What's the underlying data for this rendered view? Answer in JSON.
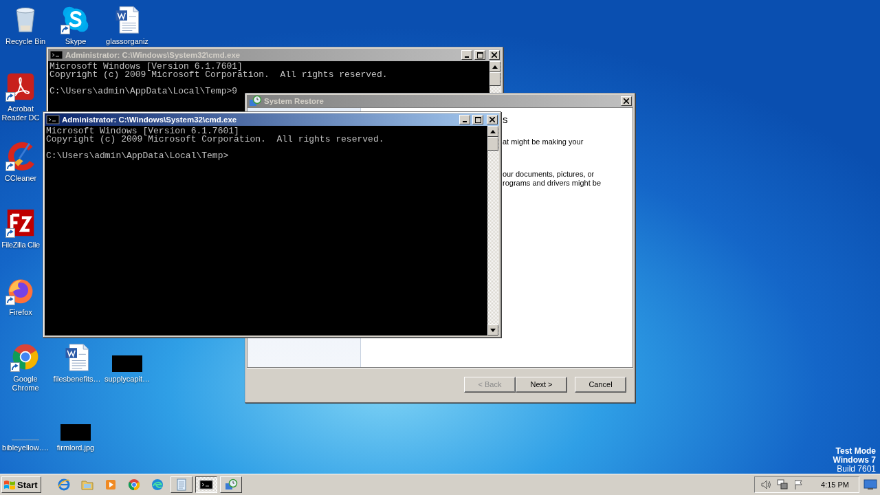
{
  "desktop_icons": [
    {
      "label": "Recycle Bin",
      "kind": "recycle",
      "shortcut": false
    },
    {
      "label": "Skype",
      "kind": "skype",
      "shortcut": true
    },
    {
      "label": "glassorganiz",
      "kind": "word",
      "shortcut": false
    },
    {
      "label": "Acrobat Reader DC",
      "kind": "acrobat",
      "shortcut": true
    },
    {
      "label": "CCleaner",
      "kind": "ccleaner",
      "shortcut": true
    },
    {
      "label": "FileZilla Clie",
      "kind": "filezilla",
      "shortcut": true
    },
    {
      "label": "Firefox",
      "kind": "firefox",
      "shortcut": true
    },
    {
      "label": "Google Chrome",
      "kind": "chrome",
      "shortcut": true
    },
    {
      "label": "filesbenefits…",
      "kind": "word",
      "shortcut": false
    },
    {
      "label": "supplycapit…",
      "kind": "blackimage",
      "shortcut": false
    },
    {
      "label": "bibleyellow….",
      "kind": "blank",
      "shortcut": false
    },
    {
      "label": "firmlord.jpg",
      "kind": "blackimage",
      "shortcut": false
    }
  ],
  "windows": [
    {
      "kind": "console",
      "title": "Administrator: C:\\Windows\\System32\\cmd.exe",
      "active": false,
      "output": [
        "Microsoft Windows [Version 6.1.7601]",
        "Copyright (c) 2009 Microsoft Corporation.  All rights reserved."
      ],
      "prompt": "C:\\Users\\admin\\AppData\\Local\\Temp>9"
    },
    {
      "kind": "wizard",
      "title": "System Restore",
      "active": false,
      "paragraphs": [
        {
          "kind": "heading",
          "lines": [
            "s"
          ]
        },
        {
          "kind": "body",
          "lines": [
            "at might be making your"
          ]
        },
        {
          "kind": "body",
          "lines": [
            "our documents, pictures, or",
            "rograms and drivers might be"
          ]
        }
      ],
      "buttons": [
        {
          "label": "< Back",
          "disabled": true
        },
        {
          "label": "Next >",
          "disabled": false
        },
        {
          "label": "Cancel",
          "disabled": false
        }
      ]
    },
    {
      "kind": "console",
      "title": "Administrator: C:\\Windows\\System32\\cmd.exe",
      "active": true,
      "output": [
        "Microsoft Windows [Version 6.1.7601]",
        "Copyright (c) 2009 Microsoft Corporation.  All rights reserved."
      ],
      "prompt": "C:\\Users\\admin\\AppData\\Local\\Temp>"
    }
  ],
  "os_notice": [
    "Test Mode",
    "Windows 7",
    "Build 7601"
  ],
  "taskbar": {
    "start": "Start",
    "pinned": [
      {
        "kind": "ie"
      },
      {
        "kind": "folder"
      },
      {
        "kind": "media"
      },
      {
        "kind": "chrome"
      },
      {
        "kind": "edge"
      }
    ],
    "tasks": [
      {
        "kind": "notepad",
        "active": false
      },
      {
        "kind": "console",
        "active": true
      },
      {
        "kind": "restore",
        "active": false
      }
    ],
    "tray": [
      {
        "kind": "speaker"
      },
      {
        "kind": "network"
      },
      {
        "kind": "flag"
      }
    ],
    "clock": "4:15 PM"
  }
}
